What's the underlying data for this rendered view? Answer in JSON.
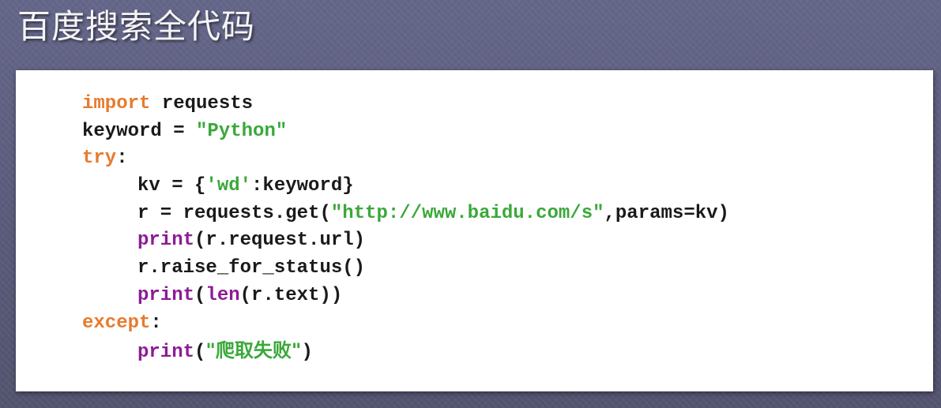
{
  "slide": {
    "title": "百度搜索全代码"
  },
  "code": {
    "line1": {
      "kw": "import",
      "rest": " requests"
    },
    "line2": {
      "lhs": "keyword = ",
      "str": "\"Python\""
    },
    "line3": {
      "kw": "try",
      "rest": ":"
    },
    "line4": {
      "a": "kv = {",
      "str": "'wd'",
      "b": ":keyword}"
    },
    "line5": {
      "a": "r = requests.get(",
      "str": "\"http://www.baidu.com/s\"",
      "b": ",params=kv)"
    },
    "line6": {
      "fn": "print",
      "rest": "(r.request.url)"
    },
    "line7": {
      "text": "r.raise_for_status()"
    },
    "line8": {
      "fn": "print",
      "open": "(",
      "fn2": "len",
      "rest": "(r.text))"
    },
    "line9": {
      "kw": "except",
      "rest": ":"
    },
    "line10": {
      "fn": "print",
      "open": "(",
      "str": "\"爬取失败\"",
      "close": ")"
    }
  },
  "colors": {
    "keyword": "#e87a2e",
    "string": "#3aa83a",
    "builtin": "#8d1b97",
    "text": "#1a1a1a",
    "background": "#5d5e7e",
    "panel": "#ffffff"
  }
}
